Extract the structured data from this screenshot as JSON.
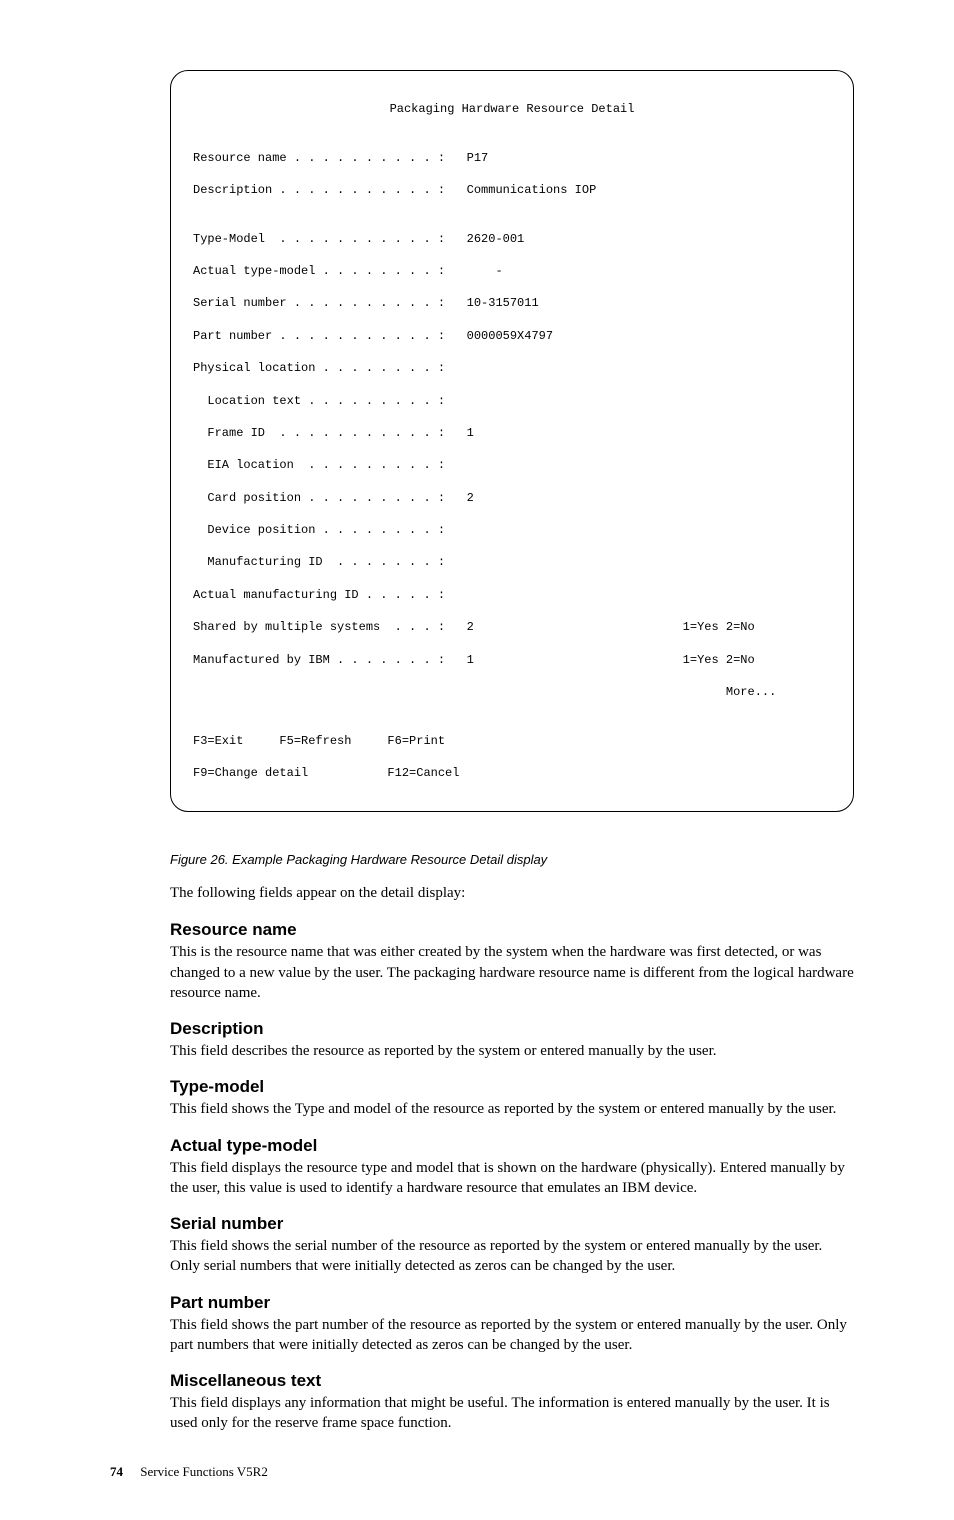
{
  "terminal": {
    "title": "Packaging Hardware Resource Detail",
    "lines": [
      "",
      "Resource name . . . . . . . . . . :   P17",
      "Description . . . . . . . . . . . :   Communications IOP",
      "",
      "Type-Model  . . . . . . . . . . . :   2620-001",
      "Actual type-model . . . . . . . . :       -",
      "Serial number . . . . . . . . . . :   10-3157011",
      "Part number . . . . . . . . . . . :   0000059X4797",
      "Physical location . . . . . . . . :",
      "  Location text . . . . . . . . . :",
      "  Frame ID  . . . . . . . . . . . :   1",
      "  EIA location  . . . . . . . . . :",
      "  Card position . . . . . . . . . :   2",
      "  Device position . . . . . . . . :",
      "  Manufacturing ID  . . . . . . . :",
      "Actual manufacturing ID . . . . . :",
      "Shared by multiple systems  . . . :   2                             1=Yes 2=No",
      "Manufactured by IBM . . . . . . . :   1                             1=Yes 2=No",
      "                                                                          More...",
      "",
      "F3=Exit     F5=Refresh     F6=Print",
      "F9=Change detail           F12=Cancel"
    ]
  },
  "figure_caption": "Figure 26. Example Packaging Hardware Resource Detail display",
  "intro_text": "The following fields appear on the detail display:",
  "sections": [
    {
      "title": "Resource name",
      "body": "This is the resource name that was either created by the system when the hardware was first detected, or was changed to a new value by the user. The packaging hardware resource name is different from the logical hardware resource name."
    },
    {
      "title": "Description",
      "body": "This field describes the resource as reported by the system or entered manually by the user."
    },
    {
      "title": "Type-model",
      "body": "This field shows the Type and model of the resource as reported by the system or entered manually by the user."
    },
    {
      "title": "Actual type-model",
      "body": "This field displays the resource type and model that is shown on the hardware (physically). Entered manually by the user, this value is used to identify a hardware resource that emulates an IBM device."
    },
    {
      "title": "Serial number",
      "body": "This field shows the serial number of the resource as reported by the system or entered manually by the user. Only serial numbers that were initially detected as zeros can be changed by the user."
    },
    {
      "title": "Part number",
      "body": "This field shows the part number of the resource as reported by the system or entered manually by the user. Only part numbers that were initially detected as zeros can be changed by the user."
    },
    {
      "title": "Miscellaneous text",
      "body": "This field displays any information that might be useful. The information is entered manually by the user. It is used only for the reserve frame space function."
    }
  ],
  "footer": {
    "page_number": "74",
    "doc_title": "Service Functions V5R2"
  }
}
